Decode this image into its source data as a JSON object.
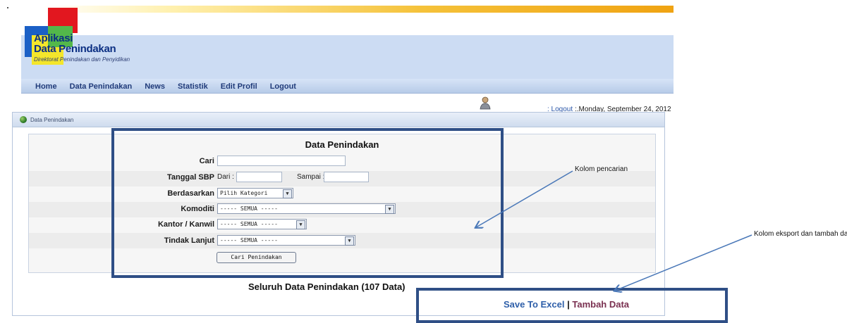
{
  "logo": {
    "title_line1": "Aplikasi",
    "title_line2": "Data Penindakan",
    "subtitle": "Direktorat Penindakan dan Penyidikan"
  },
  "nav": {
    "items": [
      "Home",
      "Data Penindakan",
      "News",
      "Statistik",
      "Edit Profil",
      "Logout"
    ]
  },
  "user_bar": {
    "logout_label": ": Logout",
    "date_text": ":.Monday, September 24, 2012"
  },
  "panel": {
    "breadcrumb": "Data Penindakan"
  },
  "form": {
    "title": "Data Penindakan",
    "cari_label": "Cari",
    "cari_value": "",
    "tanggal_label": "Tanggal SBP",
    "dari_label": "Dari :",
    "sampai_label": "Sampai :",
    "berdasarkan_label": "Berdasarkan",
    "berdasarkan_value": "Pilih Kategori",
    "komoditi_label": "Komoditi",
    "komoditi_value": "----- SEMUA -----",
    "kantor_label": "Kantor / Kanwil",
    "kantor_value": "----- SEMUA -----",
    "tindak_label": "Tindak Lanjut",
    "tindak_value": "----- SEMUA -----",
    "search_button": "Cari Penindakan"
  },
  "summary_text": "Seluruh Data Penindakan (107 Data)",
  "export": {
    "save_label": "Save To Excel",
    "separator": "|",
    "add_label": "Tambah Data"
  },
  "annotations": {
    "search_note": "Kolom pencarian",
    "export_note": "Kolom eksport dan tambah data",
    "color": "#2f4f86"
  },
  "colors": {
    "header_bg": "#ccdcf3",
    "nav_text": "#203b7a",
    "save_link": "#2e5fa9",
    "add_link": "#7a3050"
  }
}
